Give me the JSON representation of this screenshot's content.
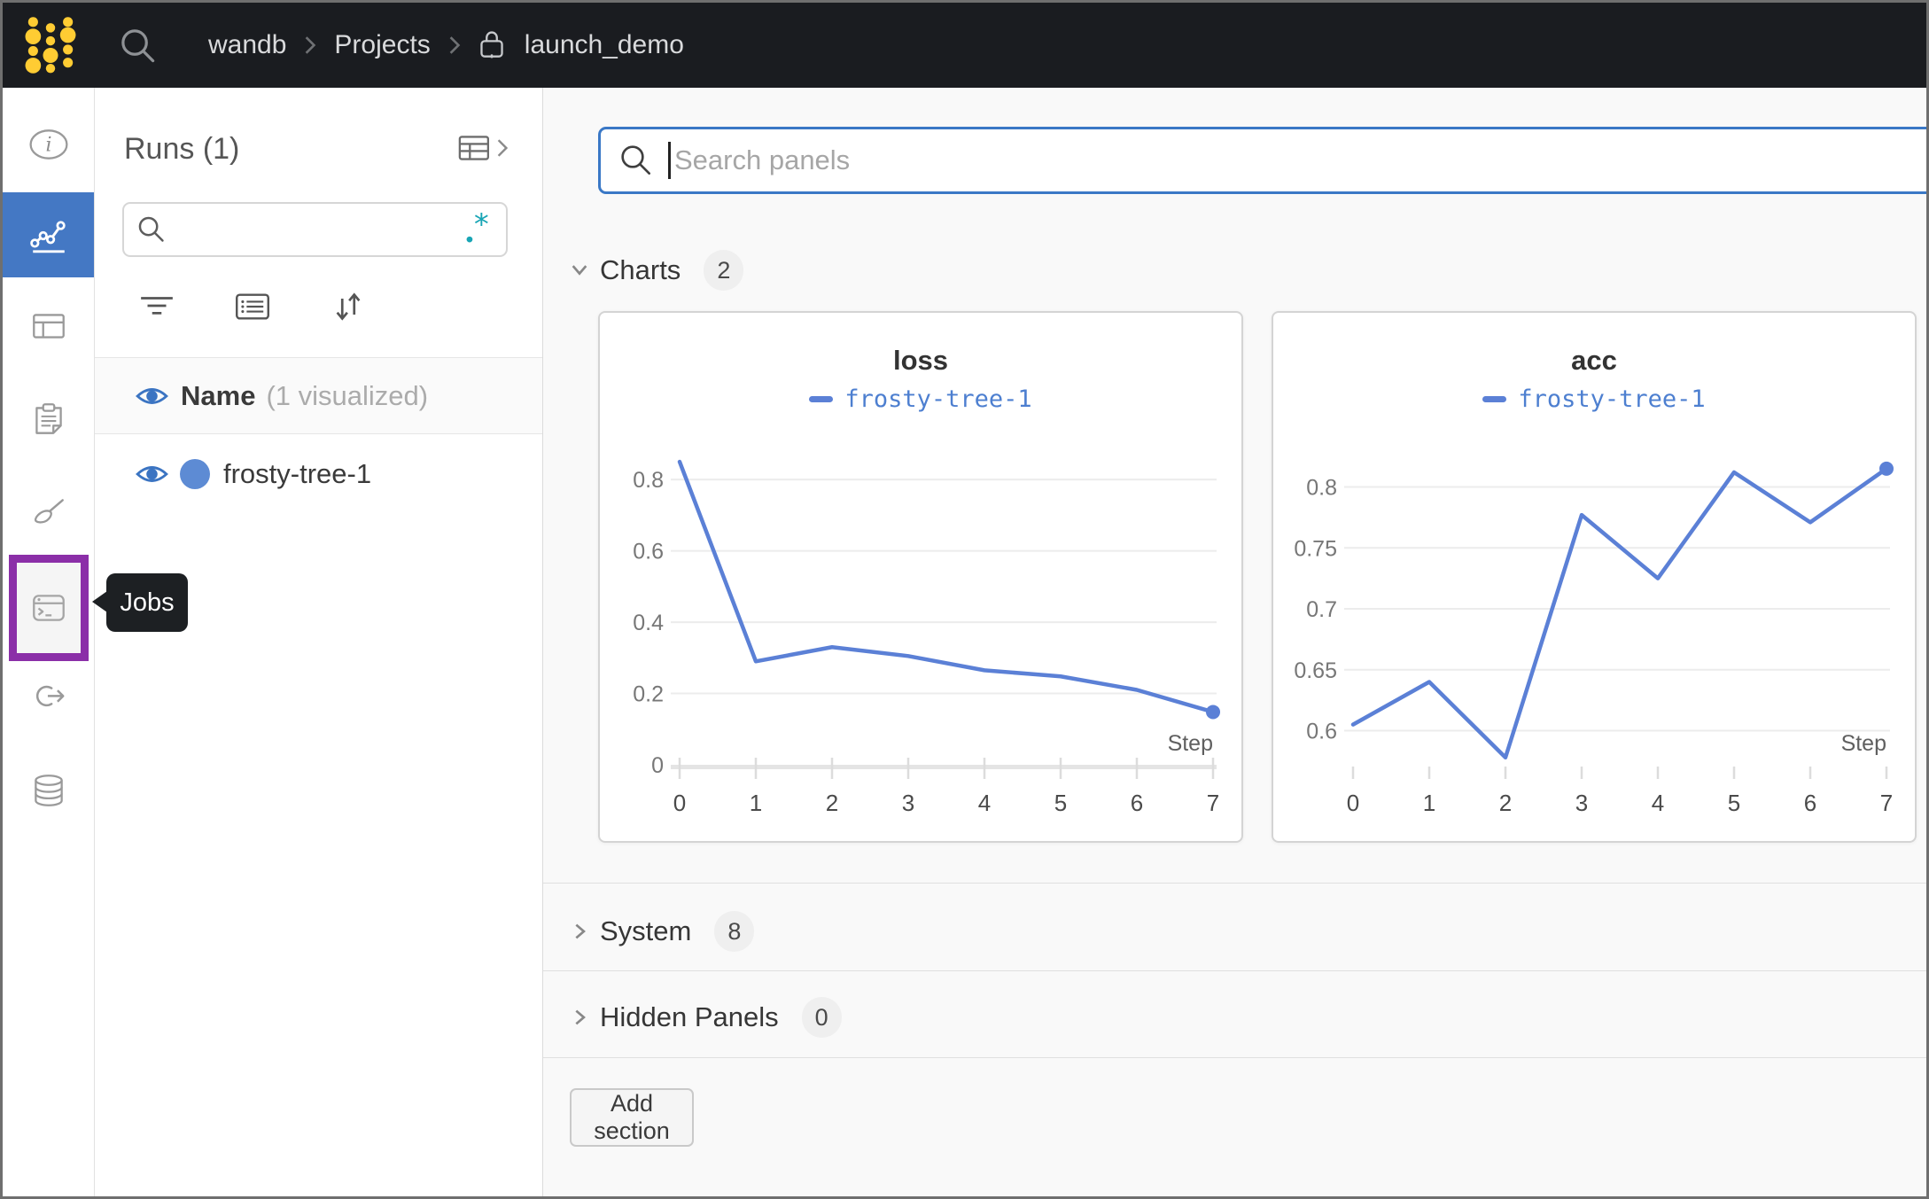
{
  "topbar": {
    "breadcrumb": {
      "org": "wandb",
      "section": "Projects",
      "project": "launch_demo"
    }
  },
  "colors": {
    "topbar_bg": "#1a1c20",
    "logo_yellow": "#ffcc33",
    "sidebar_selected_blue": "#4478c4",
    "jobs_highlight_purple": "#8b2fa8",
    "run_blue": "#5d8bd4",
    "chart_line_blue": "#5b80d6",
    "regex_teal": "#18a5b5",
    "search_focus_border": "#3a78c6"
  },
  "sidebar": {
    "tooltip": "Jobs",
    "items": [
      {
        "id": "overview",
        "icon": "info-icon",
        "selected": false
      },
      {
        "id": "charts",
        "icon": "line-chart-icon",
        "selected": true
      },
      {
        "id": "table",
        "icon": "table-icon",
        "selected": false
      },
      {
        "id": "logs",
        "icon": "clipboard-icon",
        "selected": false
      },
      {
        "id": "sweeps",
        "icon": "broom-icon",
        "selected": false
      },
      {
        "id": "jobs",
        "icon": "terminal-icon",
        "selected": false,
        "highlighted": true
      },
      {
        "id": "automations",
        "icon": "link-arrow-icon",
        "selected": false
      },
      {
        "id": "artifacts",
        "icon": "database-icon",
        "selected": false
      }
    ]
  },
  "runs_panel": {
    "title": "Runs (1)",
    "search_value": "",
    "header": {
      "label": "Name",
      "sub": "(1 visualized)"
    },
    "runs": [
      {
        "name": "frosty-tree-1",
        "color": "#5d8bd4",
        "visible": true
      }
    ]
  },
  "main": {
    "search": {
      "placeholder": "Search panels",
      "value": ""
    },
    "sections": [
      {
        "label": "Charts",
        "count": "2",
        "expanded": true
      },
      {
        "label": "System",
        "count": "8",
        "expanded": false
      },
      {
        "label": "Hidden Panels",
        "count": "0",
        "expanded": false
      }
    ],
    "add_section_label": "Add section"
  },
  "chart_data": [
    {
      "type": "line",
      "title": "loss",
      "xlabel": "Step",
      "x": [
        0,
        1,
        2,
        3,
        4,
        5,
        6,
        7
      ],
      "series": [
        {
          "name": "frosty-tree-1",
          "color": "#5b80d6",
          "values": [
            0.85,
            0.29,
            0.33,
            0.305,
            0.265,
            0.248,
            0.21,
            0.148
          ]
        }
      ],
      "yticks": [
        0,
        0.2,
        0.4,
        0.6,
        0.8
      ],
      "ytick_labels": [
        "0",
        "0.2",
        "0.4",
        "0.6",
        "0.8"
      ],
      "ylim": [
        0,
        0.875
      ],
      "baseline": true,
      "grid": true,
      "legend_position": "top",
      "last_point_marker": true
    },
    {
      "type": "line",
      "title": "acc",
      "xlabel": "Step",
      "x": [
        0,
        1,
        2,
        3,
        4,
        5,
        6,
        7
      ],
      "series": [
        {
          "name": "frosty-tree-1",
          "color": "#5b80d6",
          "values": [
            0.605,
            0.64,
            0.578,
            0.777,
            0.725,
            0.812,
            0.771,
            0.815
          ]
        }
      ],
      "yticks": [
        0.6,
        0.65,
        0.7,
        0.75,
        0.8
      ],
      "ytick_labels": [
        "0.6",
        "0.65",
        "0.7",
        "0.75",
        "0.8"
      ],
      "ylim": [
        0.572,
        0.828
      ],
      "baseline": false,
      "grid": true,
      "legend_position": "top",
      "last_point_marker": true
    }
  ]
}
